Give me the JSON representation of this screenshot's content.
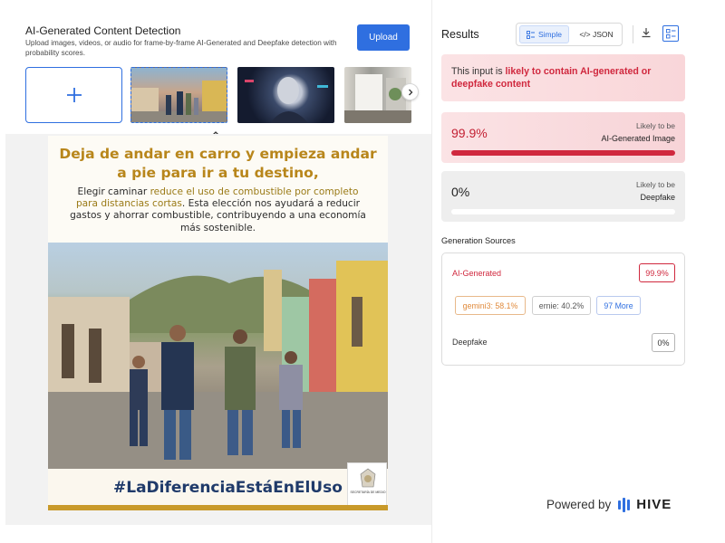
{
  "detector": {
    "title": "AI-Generated Content Detection",
    "description": "Upload images, videos, or audio for frame-by-frame AI-Generated and Deepfake detection with probability scores.",
    "upload_label": "Upload",
    "add_icon": "plus-icon",
    "next_icon": "chevron-right-icon",
    "collapse_icon": "chevron-up-icon"
  },
  "thumbnails": [
    {
      "id": "street-family",
      "selected": true
    },
    {
      "id": "cyber-portrait",
      "selected": false
    },
    {
      "id": "interior",
      "selected": false
    }
  ],
  "poster": {
    "headline": "Deja de andar en carro y empieza andar a pie para ir a tu destino,",
    "body_lead": "Elegir caminar ",
    "body_highlight": "reduce el uso de combustible por completo para distancias cortas",
    "body_rest": ". Esta elección nos ayudará a reducir gastos y ahorrar combustible, contribuyendo a una economía más sostenible.",
    "hashtag": "#LaDiferenciaEstáEnElUso",
    "seal_text": "SECRETARÍA DE MEDIO"
  },
  "results": {
    "title": "Results",
    "view_simple": "Simple",
    "view_json": "</> JSON",
    "verdict_lead": "This input is ",
    "verdict_highlight": "likely to contain AI-generated or deepfake content",
    "ai_score": "99.9%",
    "ai_score_fraction": 0.999,
    "ai_label_top": "Likely to be",
    "ai_label_bottom": "AI-Generated Image",
    "df_score": "0%",
    "df_score_fraction": 0.0,
    "df_label_top": "Likely to be",
    "df_label_bottom": "Deepfake",
    "sources_title": "Generation Sources",
    "src_ai_label": "AI-Generated",
    "src_ai_pct": "99.9%",
    "chips": {
      "gemini": "gemini3: 58.1%",
      "ernie": "ernie: 40.2%",
      "more": "97 More"
    },
    "src_df_label": "Deepfake",
    "src_df_pct": "0%"
  },
  "footer": {
    "powered_by": "Powered by",
    "brand": "HIVE"
  },
  "colors": {
    "accent": "#2f6fe0",
    "alert": "#d0283e",
    "chip_orange": "#e08a3c",
    "poster_gold": "#b8861b"
  }
}
